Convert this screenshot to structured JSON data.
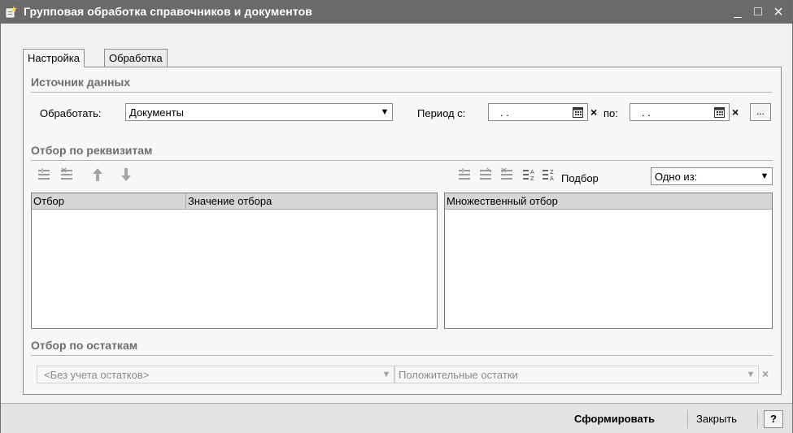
{
  "window": {
    "title": "Групповая обработка справочников и документов",
    "minimize": "_",
    "maximize": "□",
    "close": "×"
  },
  "tabs": [
    {
      "label": "Настройка",
      "active": true
    },
    {
      "label": "Обработка",
      "active": false
    }
  ],
  "source": {
    "section_title": "Источник данных",
    "process_label": "Обработать:",
    "process_value": "Документы",
    "period_from_label": "Период с:",
    "period_from_value": ". .",
    "period_to_label": "по:",
    "period_to_value": ". .",
    "clear_symbol": "×",
    "more_label": "..."
  },
  "filter_attrs": {
    "section_title": "Отбор по реквизитам",
    "left_columns": [
      "Отбор",
      "Значение отбора"
    ],
    "right_columns": [
      "Множественный отбор"
    ],
    "selection_label": "Подбор",
    "selection_mode": "Одно из:"
  },
  "filter_balance": {
    "section_title": "Отбор по остаткам",
    "balance_mode": "<Без учета остатков>",
    "balance_type": "Положительные остатки",
    "clear_symbol": "×"
  },
  "footer": {
    "generate_label": "Сформировать",
    "close_label": "Закрыть",
    "help_label": "?"
  },
  "colors": {
    "titlebar": "#6a6a6a",
    "section_title": "#6e6e6e",
    "grid_header": "#d6d6d6"
  }
}
